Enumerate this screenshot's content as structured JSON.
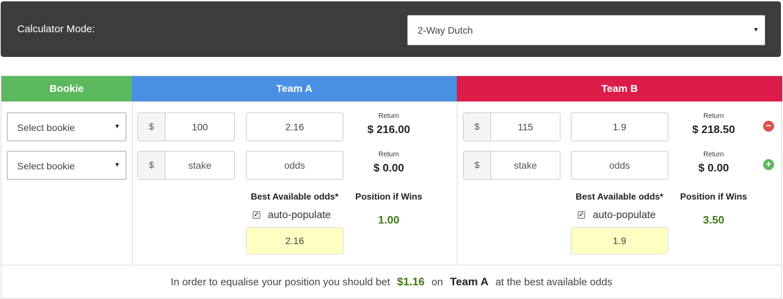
{
  "header": {
    "mode_label": "Calculator Mode:",
    "mode_value": "2-Way Dutch"
  },
  "columns": {
    "bookie": "Bookie",
    "team_a": "Team A",
    "team_b": "Team B"
  },
  "bookie_rows": [
    {
      "label": "Select bookie"
    },
    {
      "label": "Select bookie"
    }
  ],
  "currency": "$",
  "team_a": {
    "rows": [
      {
        "stake": "100",
        "stake_placeholder": "stake",
        "odds": "2.16",
        "odds_placeholder": "odds",
        "return_label": "Return",
        "return_value": "$ 216.00"
      },
      {
        "stake": "",
        "stake_placeholder": "stake",
        "odds": "",
        "odds_placeholder": "odds",
        "return_label": "Return",
        "return_value": "$ 0.00"
      }
    ],
    "best_odds_label": "Best Available odds*",
    "auto_label": "auto-populate",
    "auto_checked": true,
    "best_odds_value": "2.16",
    "position_label": "Position if Wins",
    "position_value": "1.00"
  },
  "team_b": {
    "rows": [
      {
        "stake": "115",
        "stake_placeholder": "stake",
        "odds": "1.9",
        "odds_placeholder": "odds",
        "return_label": "Return",
        "return_value": "$ 218.50"
      },
      {
        "stake": "",
        "stake_placeholder": "stake",
        "odds": "",
        "odds_placeholder": "odds",
        "return_label": "Return",
        "return_value": "$ 0.00"
      }
    ],
    "best_odds_label": "Best Available odds*",
    "auto_label": "auto-populate",
    "auto_checked": true,
    "best_odds_value": "1.9",
    "position_label": "Position if Wins",
    "position_value": "3.50"
  },
  "row_actions": [
    {
      "icon": "remove-icon",
      "glyph": "−"
    },
    {
      "icon": "add-icon",
      "glyph": "+"
    }
  ],
  "footer": {
    "prefix": "In order to equalise your position you should bet",
    "amount": "$1.16",
    "on": "on",
    "team": "Team A",
    "suffix": "at the best available odds"
  },
  "colors": {
    "bookie_header": "#5cb85c",
    "team_a_header": "#4a90e2",
    "team_b_header": "#dc1d4a",
    "positive": "#3c7a17",
    "best_odds_bg": "#ffffc4"
  }
}
